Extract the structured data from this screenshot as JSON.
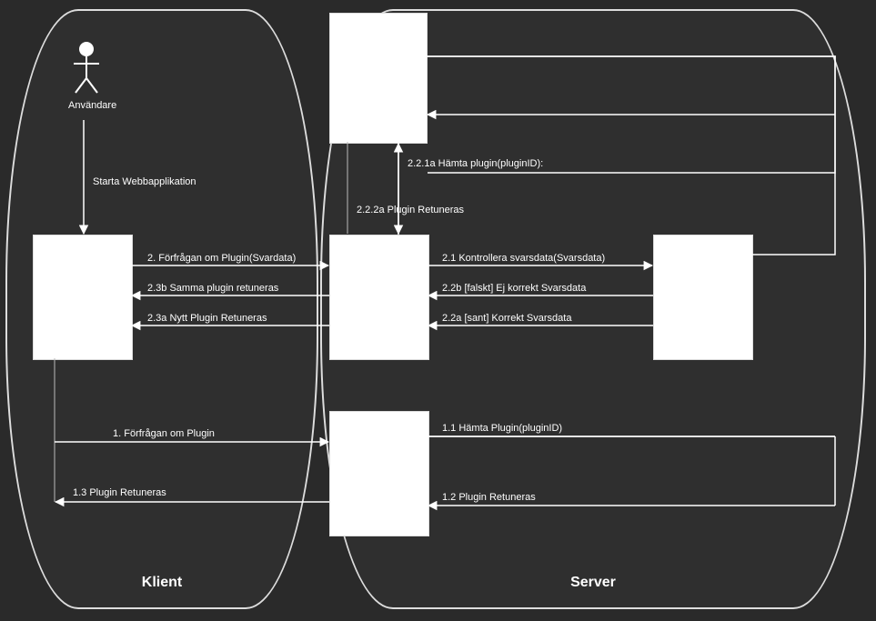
{
  "panels": {
    "client": "Klient",
    "server": "Server"
  },
  "actor": {
    "label": "Användare"
  },
  "messages": {
    "start_app": "Starta Webbapplikation",
    "m2_req_plugin_svar": "2. Förfrågan om Plugin(Svardata)",
    "m2_3b_same_plugin": "2.3b Samma plugin retuneras",
    "m2_3a_new_plugin": "2.3a Nytt Plugin Retuneras",
    "m2_1_kontrollera": "2.1 Kontrollera svarsdata(Svarsdata)",
    "m2_2b_falskt": "2.2b [falskt]  Ej korrekt Svarsdata",
    "m2_2a_sant": "2.2a [sant]  Korrekt Svarsdata",
    "m2_2_1a_hamta": "2.2.1a Hämta plugin(pluginID):",
    "m2_2_2a_plugin_ret": "2.2.2a Plugin Retuneras",
    "m1_req_plugin": "1. Förfrågan om Plugin",
    "m1_1_hamta": "1.1 Hämta Plugin(pluginID)",
    "m1_3_plugin_ret": "1.3 Plugin Retuneras",
    "m1_2_plugin_ret": "1.2 Plugin Retuneras"
  }
}
